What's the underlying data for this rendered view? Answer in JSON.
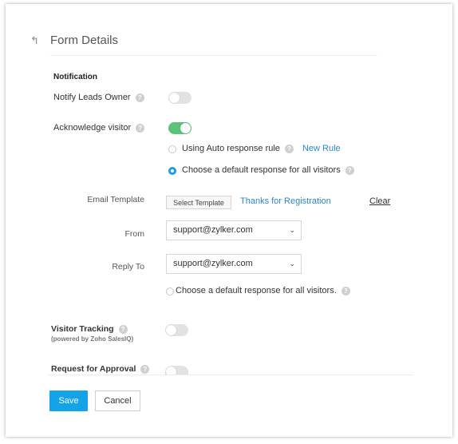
{
  "header": {
    "back_icon": "back-arrow-icon",
    "title": "Form Details"
  },
  "notification": {
    "section_title": "Notification",
    "notify_leads_owner": {
      "label": "Notify Leads Owner",
      "enabled": false
    },
    "acknowledge_visitor": {
      "label": "Acknowledge visitor",
      "enabled": true
    },
    "options": [
      {
        "label": "Using Auto response rule",
        "selected": false,
        "link": "New Rule"
      },
      {
        "label": "Choose a default response for all visitors",
        "selected": true
      }
    ],
    "email_template": {
      "label": "Email Template",
      "button": "Select Template",
      "selected": "Thanks for Registration",
      "clear": "Clear"
    },
    "from": {
      "label": "From",
      "value": "support@zylker.com"
    },
    "reply_to": {
      "label": "Reply To",
      "value": "support@zylker.com"
    },
    "extra_option": {
      "label": "Choose a default response for all visitors.",
      "selected": false
    }
  },
  "visitor_tracking": {
    "label": "Visitor Tracking",
    "sublabel": "(powered by Zoho SalesIQ)",
    "enabled": false
  },
  "request_for_approval": {
    "label": "Request for Approval",
    "enabled": false
  },
  "help_glyph": "?",
  "chevron_glyph": "⌄",
  "back_glyph": "↰",
  "footer": {
    "save": "Save",
    "cancel": "Cancel"
  },
  "colors": {
    "accent": "#14a3e6",
    "toggle_on": "#5bc27a",
    "link": "#2a88c8"
  }
}
